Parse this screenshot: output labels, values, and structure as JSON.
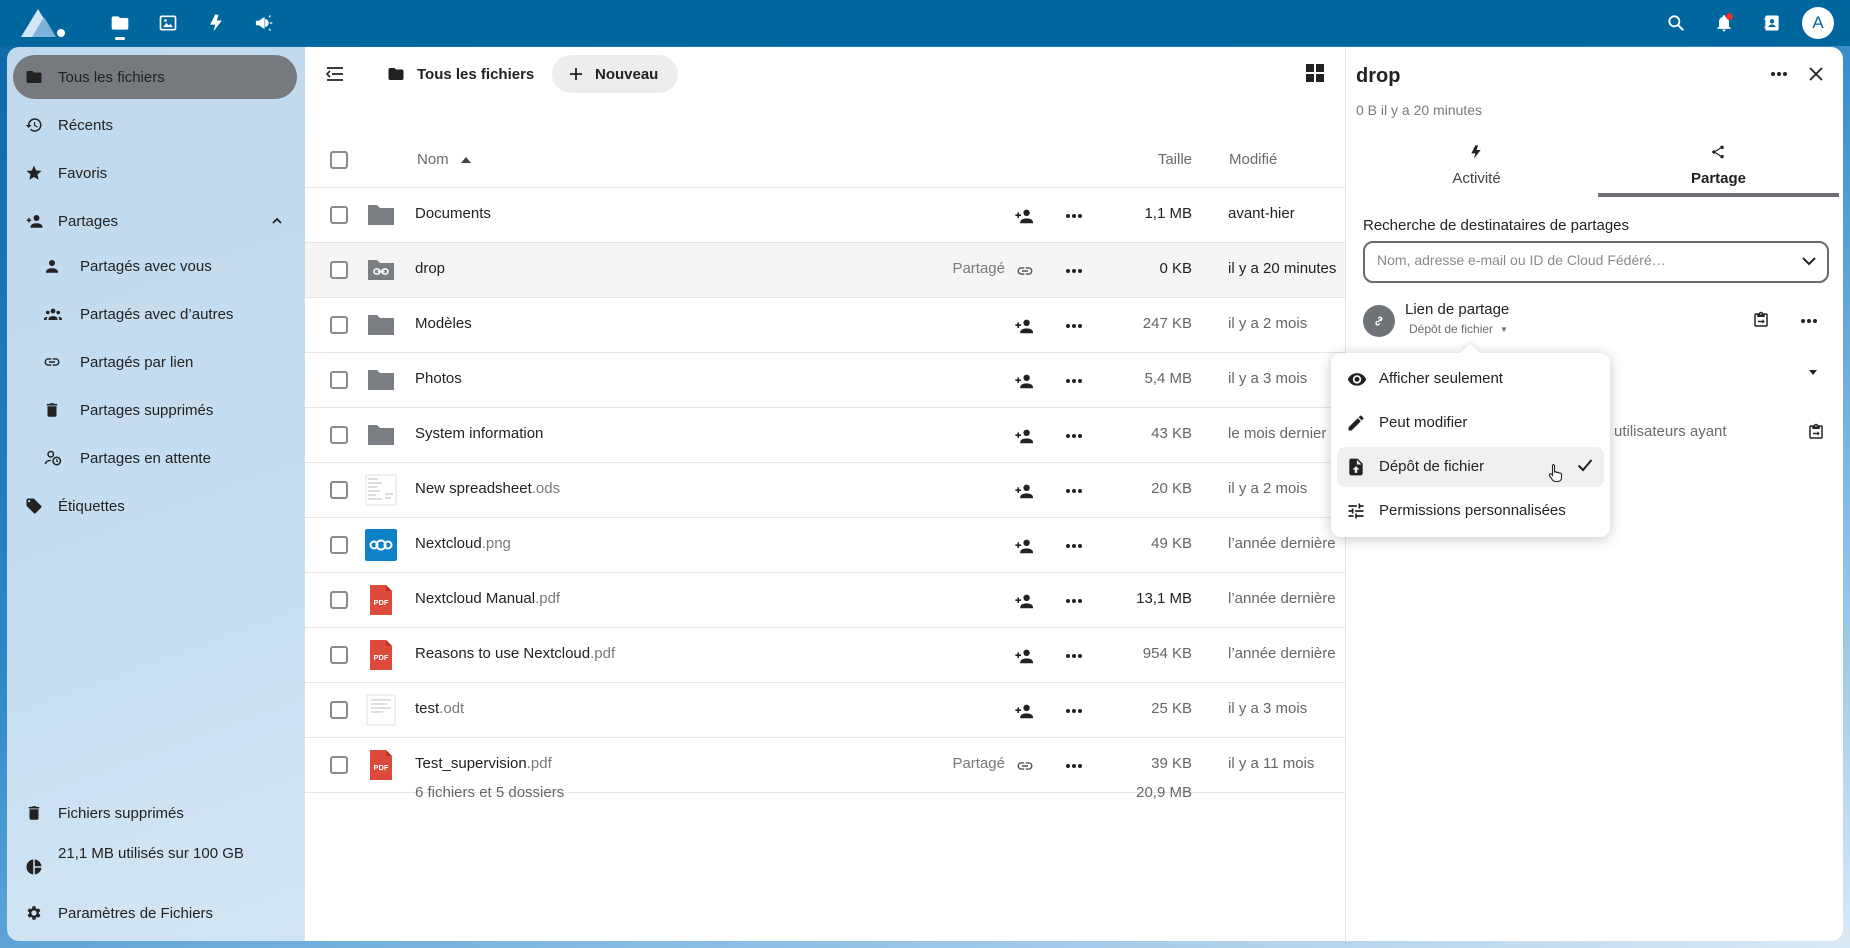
{
  "topbar": {
    "apps": [
      {
        "name": "files",
        "icon": "folder-icon"
      },
      {
        "name": "photos",
        "icon": "image-icon"
      },
      {
        "name": "activity",
        "icon": "lightning-icon"
      },
      {
        "name": "announcements",
        "icon": "megaphone-icon"
      }
    ],
    "avatar_letter": "A",
    "brand_color": "#00679e"
  },
  "sidebar": {
    "items": [
      {
        "label": "Tous les fichiers",
        "icon": "folder-icon",
        "active": true
      },
      {
        "label": "Récents",
        "icon": "history-icon"
      },
      {
        "label": "Favoris",
        "icon": "star-icon"
      },
      {
        "label": "Partages",
        "icon": "share-person-icon",
        "expanded": true
      },
      {
        "label": "Partagés avec vous",
        "icon": "person-icon"
      },
      {
        "label": "Partagés avec d’autres",
        "icon": "group-icon"
      },
      {
        "label": "Partagés par lien",
        "icon": "link-icon"
      },
      {
        "label": "Partages supprimés",
        "icon": "trash-icon"
      },
      {
        "label": "Partages en attente",
        "icon": "pending-person-icon"
      },
      {
        "label": "Étiquettes",
        "icon": "tag-icon"
      }
    ],
    "footer": {
      "trash": "Fichiers supprimés",
      "quota": "21,1 MB utilisés sur 100 GB",
      "settings": "Paramètres de Fichiers"
    }
  },
  "main": {
    "breadcrumb": "Tous les fichiers",
    "new_button": "Nouveau",
    "headers": {
      "name": "Nom",
      "size": "Taille",
      "modified": "Modifié"
    },
    "files": [
      {
        "base": "Documents",
        "ext": "",
        "type": "folder",
        "size": "1,1 MB",
        "modified": "avant-hier"
      },
      {
        "base": "drop",
        "ext": "",
        "type": "folder-link",
        "shared": "Partagé",
        "size": "0 KB",
        "modified": "il y a 20 minutes",
        "selected": true
      },
      {
        "base": "Modèles",
        "ext": "",
        "type": "folder",
        "size": "247 KB",
        "modified": "il y a 2 mois"
      },
      {
        "base": "Photos",
        "ext": "",
        "type": "folder",
        "size": "5,4 MB",
        "modified": "il y a 3 mois"
      },
      {
        "base": "System information",
        "ext": "",
        "type": "folder",
        "size": "43 KB",
        "modified": "le mois dernier"
      },
      {
        "base": "New spreadsheet",
        "ext": ".ods",
        "type": "sheet",
        "size": "20 KB",
        "modified": "il y a 2 mois"
      },
      {
        "base": "Nextcloud",
        "ext": ".png",
        "type": "image",
        "size": "49 KB",
        "modified": "l’année dernière"
      },
      {
        "base": "Nextcloud Manual",
        "ext": ".pdf",
        "type": "pdf",
        "size": "13,1 MB",
        "modified": "l’année dernière"
      },
      {
        "base": "Reasons to use Nextcloud",
        "ext": ".pdf",
        "type": "pdf",
        "size": "954 KB",
        "modified": "l’année dernière"
      },
      {
        "base": "test",
        "ext": ".odt",
        "type": "doc",
        "size": "25 KB",
        "modified": "il y a 3 mois"
      },
      {
        "base": "Test_supervision",
        "ext": ".pdf",
        "type": "pdf",
        "shared": "Partagé",
        "size": "39 KB",
        "modified": "il y a 11 mois"
      }
    ],
    "summary": "6 fichiers et 5 dossiers",
    "total_size": "20,9 MB",
    "pdf_label": "PDF"
  },
  "panel": {
    "title": "drop",
    "subtitle": "0 B il y a 20 minutes",
    "tabs": [
      {
        "label": "Activité",
        "icon": "lightning-icon"
      },
      {
        "label": "Partage",
        "icon": "share-icon",
        "active": true
      }
    ],
    "search_label": "Recherche de destinataires de partages",
    "search_placeholder": "Nom, adresse e-mail ou ID de Cloud Fédéré…",
    "share_link": {
      "title": "Lien de partage",
      "permission": "Dépôt de fichier"
    },
    "hidden_text": "es utilisateurs ayant"
  },
  "menu": {
    "items": [
      {
        "label": "Afficher seulement",
        "icon": "eye-icon"
      },
      {
        "label": "Peut modifier",
        "icon": "pencil-icon"
      },
      {
        "label": "Dépôt de fichier",
        "icon": "file-upload-icon",
        "checked": true
      },
      {
        "label": "Permissions personnalisées",
        "icon": "tune-icon"
      }
    ]
  }
}
